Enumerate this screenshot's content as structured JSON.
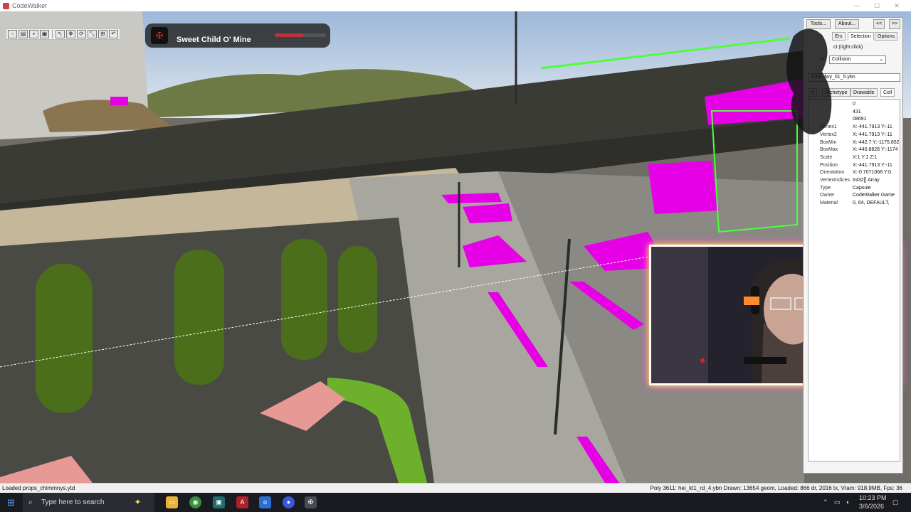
{
  "window": {
    "title": "CodeWalker"
  },
  "spotify": {
    "song": "Sweet Child O' Mine",
    "progress": 0.55
  },
  "toolbar": {
    "mode_label": "3D"
  },
  "panel": {
    "tools_label": "Tools...",
    "about_label": "About...",
    "prev_label": "<<",
    "next_label": ">>",
    "tabs": [
      "Ers",
      "Selection",
      "Options"
    ],
    "hint": "ct (right click)",
    "mode_label": "e:",
    "mode_value": "Collision",
    "file_value": "4058: fwy_01_5.ybn",
    "subtabs": [
      "ty",
      "Archetype",
      "Drawable",
      "Coll"
    ],
    "rows": [
      {
        "k": "",
        "v": "0"
      },
      {
        "k": "",
        "v": "431"
      },
      {
        "k": "",
        "v": "08691"
      },
      {
        "k": "Vertex1",
        "v": "X:-441.7913 Y:-11"
      },
      {
        "k": "Vertex2",
        "v": "X:-441.7913 Y:-11"
      },
      {
        "k": "BoxMin",
        "v": "X:-442.7 Y:-1175.852"
      },
      {
        "k": "BoxMax",
        "v": "X:-440.8826 Y:-1174"
      },
      {
        "k": "Scale",
        "v": "X:1 Y:1 Z:1"
      },
      {
        "k": "Position",
        "v": "X:-441.7913 Y:-11"
      },
      {
        "k": "Orientation",
        "v": "X:-0.7071068 Y:0."
      },
      {
        "k": "VertexIndices",
        "v": "Int32[] Array"
      },
      {
        "k": "Type",
        "v": "Capsule"
      },
      {
        "k": "Owner",
        "v": "CodeWalker.Game"
      },
      {
        "k": "Material",
        "v": "0, 64, DEFAULT,"
      }
    ]
  },
  "status": {
    "left": "Loaded props_chimmnys.ytd",
    "right": "Poly 3611: hei_kt1_rd_4.ybn  Drawn: 13654 geom, Loaded: 866 dr, 2016 tx, Vram: 918.9MB, Fps: 36"
  },
  "taskbar": {
    "search_placeholder": "Type here to search",
    "time": "10:23 PM",
    "date": "3/6/2026"
  },
  "colors": {
    "magenta": "#e600e6",
    "foliage": "#5e8e1e",
    "accent": "#ffff00"
  }
}
